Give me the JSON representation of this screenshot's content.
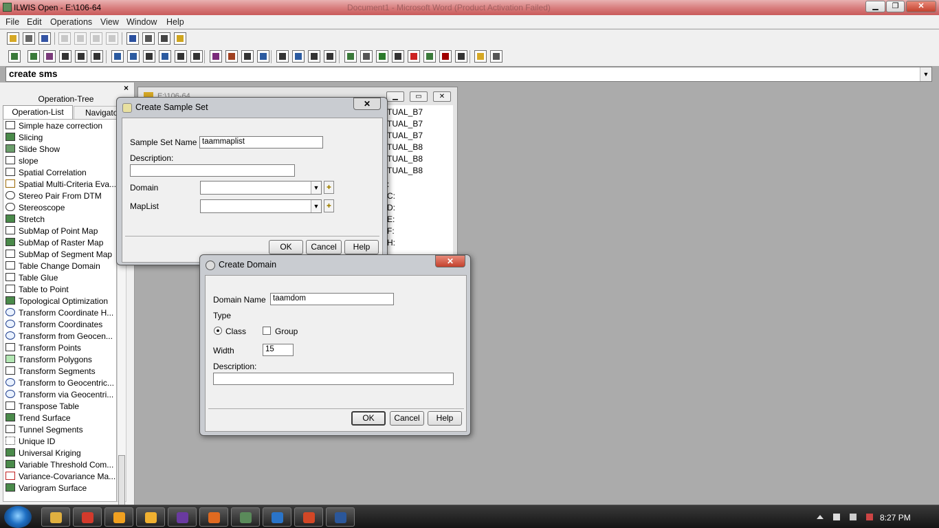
{
  "app": {
    "title": "ILWIS Open - E:\\106-64",
    "ghost_title": "Document1 - Microsoft Word (Product Activation Failed)"
  },
  "menu": [
    "File",
    "Edit",
    "Operations",
    "View",
    "Window",
    "Help"
  ],
  "command_line": {
    "value": "create sms"
  },
  "left_panel": {
    "tab_operation_tree": "Operation-Tree",
    "tab_operation_list": "Operation-List",
    "tab_navigator": "Navigator",
    "close": "×",
    "operations": [
      {
        "label": "Simple haze correction",
        "icon": "table-icon"
      },
      {
        "label": "Slicing",
        "icon": "raster-map-icon"
      },
      {
        "label": "Slide Show",
        "icon": "slideshow-icon"
      },
      {
        "label": "slope",
        "icon": "table-icon"
      },
      {
        "label": "Spatial Correlation",
        "icon": "table-icon"
      },
      {
        "label": "Spatial Multi-Criteria Eva...",
        "icon": "tree-icon"
      },
      {
        "label": "Stereo Pair From DTM",
        "icon": "stereo-icon"
      },
      {
        "label": "Stereoscope",
        "icon": "stereo-icon"
      },
      {
        "label": "Stretch",
        "icon": "raster-map-icon"
      },
      {
        "label": "SubMap of Point Map",
        "icon": "point-map-icon"
      },
      {
        "label": "SubMap of Raster Map",
        "icon": "raster-map-icon"
      },
      {
        "label": "SubMap of Segment Map",
        "icon": "segment-map-icon"
      },
      {
        "label": "Table Change Domain",
        "icon": "table-icon"
      },
      {
        "label": "Table Glue",
        "icon": "table-icon"
      },
      {
        "label": "Table to Point",
        "icon": "point-map-icon"
      },
      {
        "label": "Topological Optimization",
        "icon": "raster-map-icon"
      },
      {
        "label": "Transform Coordinate H...",
        "icon": "globe-icon"
      },
      {
        "label": "Transform Coordinates",
        "icon": "globe-icon"
      },
      {
        "label": "Transform from Geocen...",
        "icon": "globe-icon"
      },
      {
        "label": "Transform Points",
        "icon": "point-map-icon"
      },
      {
        "label": "Transform Polygons",
        "icon": "polygon-map-icon"
      },
      {
        "label": "Transform Segments",
        "icon": "segment-map-icon"
      },
      {
        "label": "Transform to Geocentric...",
        "icon": "globe-icon"
      },
      {
        "label": "Transform via Geocentri...",
        "icon": "globe-icon"
      },
      {
        "label": "Transpose Table",
        "icon": "table-icon"
      },
      {
        "label": "Trend Surface",
        "icon": "raster-map-icon"
      },
      {
        "label": "Tunnel Segments",
        "icon": "segment-map-icon"
      },
      {
        "label": "Unique ID",
        "icon": "id-icon"
      },
      {
        "label": "Universal Kriging",
        "icon": "raster-map-icon"
      },
      {
        "label": "Variable Threshold Com...",
        "icon": "raster-map-icon"
      },
      {
        "label": "Variance-Covariance Ma...",
        "icon": "matrix-icon"
      },
      {
        "label": "Variogram Surface",
        "icon": "raster-map-icon"
      }
    ]
  },
  "catalog": {
    "title": "E:\\106-64",
    "items": [
      "TUAL_B7",
      "TUAL_B7",
      "TUAL_B7",
      "TUAL_B8",
      "TUAL_B8",
      "TUAL_B8"
    ],
    "fragments": [
      ":",
      "C:",
      "D:",
      "E:",
      "F:",
      "H:"
    ]
  },
  "create_sample_set": {
    "title": "Create Sample Set",
    "sample_set_name_label": "Sample Set Name",
    "sample_set_name_value": "taammaplist",
    "description_label": "Description:",
    "domain_label": "Domain",
    "maplist_label": "MapList",
    "ok": "OK",
    "cancel": "Cancel",
    "help": "Help",
    "close": "✕"
  },
  "create_domain": {
    "title": "Create Domain",
    "domain_name_label": "Domain Name",
    "domain_name_value": "taamdom",
    "type_label": "Type",
    "class_label": "Class",
    "group_label": "Group",
    "class_selected": true,
    "group_checked": false,
    "width_label": "Width",
    "width_value": "15",
    "description_label": "Description:",
    "ok": "OK",
    "cancel": "Cancel",
    "help": "Help",
    "close": "✕"
  },
  "taskbar": {
    "clock": "8:27 PM",
    "apps": [
      "explorer-icon",
      "chrome-icon",
      "orb-icon",
      "media-player-icon",
      "visual-studio-icon",
      "firefox-icon",
      "ilwis-icon",
      "ie-icon",
      "powerpoint-icon",
      "word-icon"
    ]
  },
  "colors": {
    "title_gradient": "#d77b7b",
    "desktop_gray": "#ababab",
    "taskbar": "#1e1e1e"
  }
}
